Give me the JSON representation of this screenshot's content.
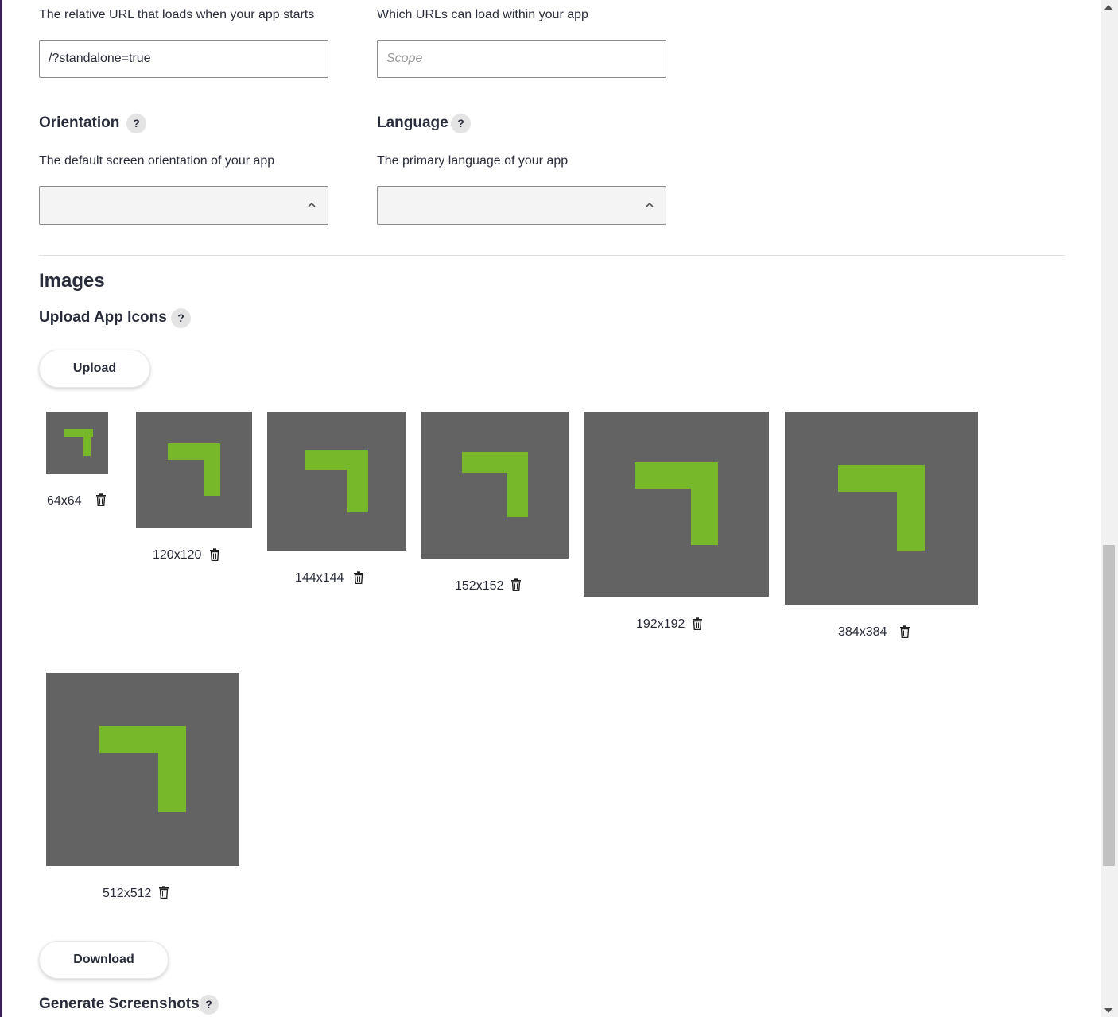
{
  "start_url": {
    "description": "The relative URL that loads when your app starts",
    "value": "/?standalone=true"
  },
  "scope": {
    "description": "Which URLs can load within your app",
    "placeholder": "Scope"
  },
  "orientation": {
    "label": "Orientation",
    "help": "?",
    "description": "The default screen orientation of your app",
    "value": ""
  },
  "language": {
    "label": "Language",
    "help": "?",
    "description": "The primary language of your app",
    "value": ""
  },
  "images": {
    "heading": "Images",
    "upload_icons_label": "Upload App Icons",
    "help": "?",
    "upload_button": "Upload",
    "icons": [
      {
        "size": "64x64"
      },
      {
        "size": "120x120"
      },
      {
        "size": "144x144"
      },
      {
        "size": "152x152"
      },
      {
        "size": "192x192"
      },
      {
        "size": "384x384"
      },
      {
        "size": "512x512"
      }
    ],
    "download_button": "Download",
    "screenshots_label": "Generate Screenshots",
    "screenshots_help": "?"
  },
  "colors": {
    "icon_background": "#636363",
    "icon_glyph": "#76b82a",
    "left_accent": "#3c1f54"
  }
}
